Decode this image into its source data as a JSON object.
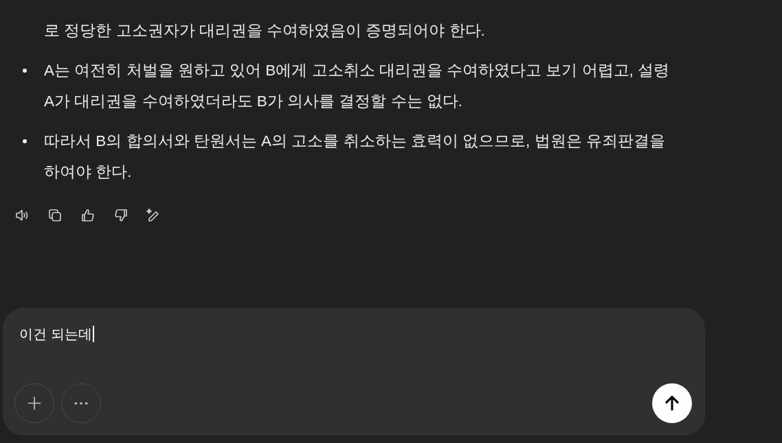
{
  "message": {
    "bullets": [
      {
        "text": "로 정당한 고소권자가 대리권을 수여하였음이 증명되어야 한다.",
        "kind": "continued"
      },
      {
        "text": "A는 여전히 처벌을 원하고 있어 B에게 고소취소 대리권을 수여하였다고 보기 어렵고, 설령 A가 대리권을 수여하였더라도 B가 의사를 결정할 수는 없다.",
        "kind": "item"
      },
      {
        "text": "따라서 B의 합의서와 탄원서는 A의 고소를 취소하는 효력이 없으므로, 법원은 유죄판결을 하여야 한다.",
        "kind": "item"
      }
    ]
  },
  "actions": [
    {
      "kind": "speaker"
    },
    {
      "kind": "copy"
    },
    {
      "kind": "like"
    },
    {
      "kind": "dislike"
    },
    {
      "kind": "edit"
    }
  ],
  "composer": {
    "value": "이건 되는데",
    "buttons": [
      {
        "kind": "plus"
      },
      {
        "kind": "more"
      }
    ],
    "send": {
      "kind": "send"
    }
  }
}
